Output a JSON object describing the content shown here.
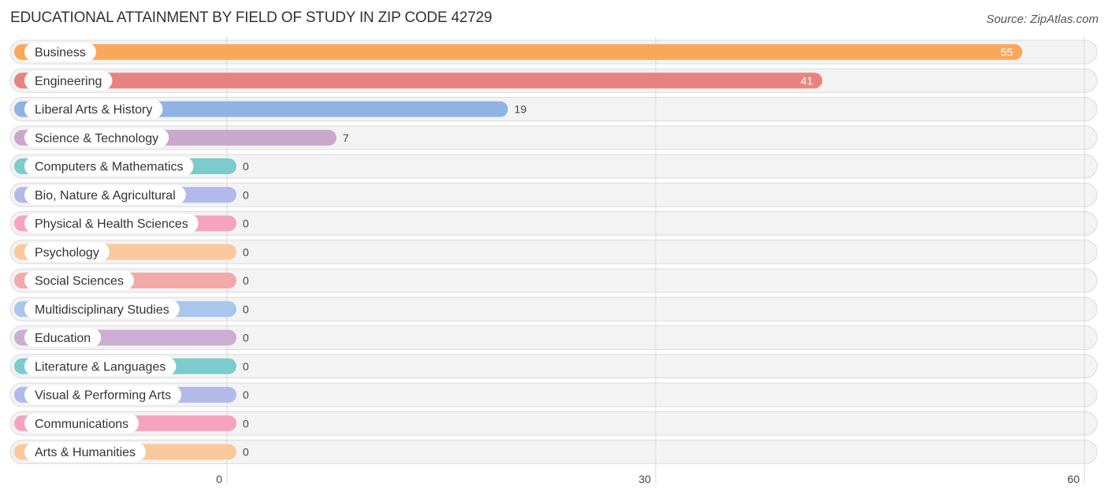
{
  "header": {
    "title": "EDUCATIONAL ATTAINMENT BY FIELD OF STUDY IN ZIP CODE 42729",
    "source": "Source: ZipAtlas.com"
  },
  "chart_data": {
    "type": "bar",
    "orientation": "horizontal",
    "title": "EDUCATIONAL ATTAINMENT BY FIELD OF STUDY IN ZIP CODE 42729",
    "xlabel": "",
    "ylabel": "",
    "xlim": [
      0,
      60
    ],
    "xticks": [
      0,
      30,
      60
    ],
    "grid": true,
    "categories": [
      "Business",
      "Engineering",
      "Liberal Arts & History",
      "Science & Technology",
      "Computers & Mathematics",
      "Bio, Nature & Agricultural",
      "Physical & Health Sciences",
      "Psychology",
      "Social Sciences",
      "Multidisciplinary Studies",
      "Education",
      "Literature & Languages",
      "Visual & Performing Arts",
      "Communications",
      "Arts & Humanities"
    ],
    "values": [
      55,
      41,
      19,
      7,
      0,
      0,
      0,
      0,
      0,
      0,
      0,
      0,
      0,
      0,
      0
    ],
    "colors": [
      "#f9a85b",
      "#e8847f",
      "#8fb4e3",
      "#c9a8cc",
      "#7ccbcd",
      "#b3b9e8",
      "#f5a3bf",
      "#fac99b",
      "#efaaa9",
      "#a9c7ec",
      "#ccaed3",
      "#7ccbcd",
      "#b3b9e8",
      "#f5a3bf",
      "#fac99b"
    ],
    "value_label_inside": [
      true,
      true,
      false,
      false,
      false,
      false,
      false,
      false,
      false,
      false,
      false,
      false,
      false,
      false,
      false
    ]
  }
}
